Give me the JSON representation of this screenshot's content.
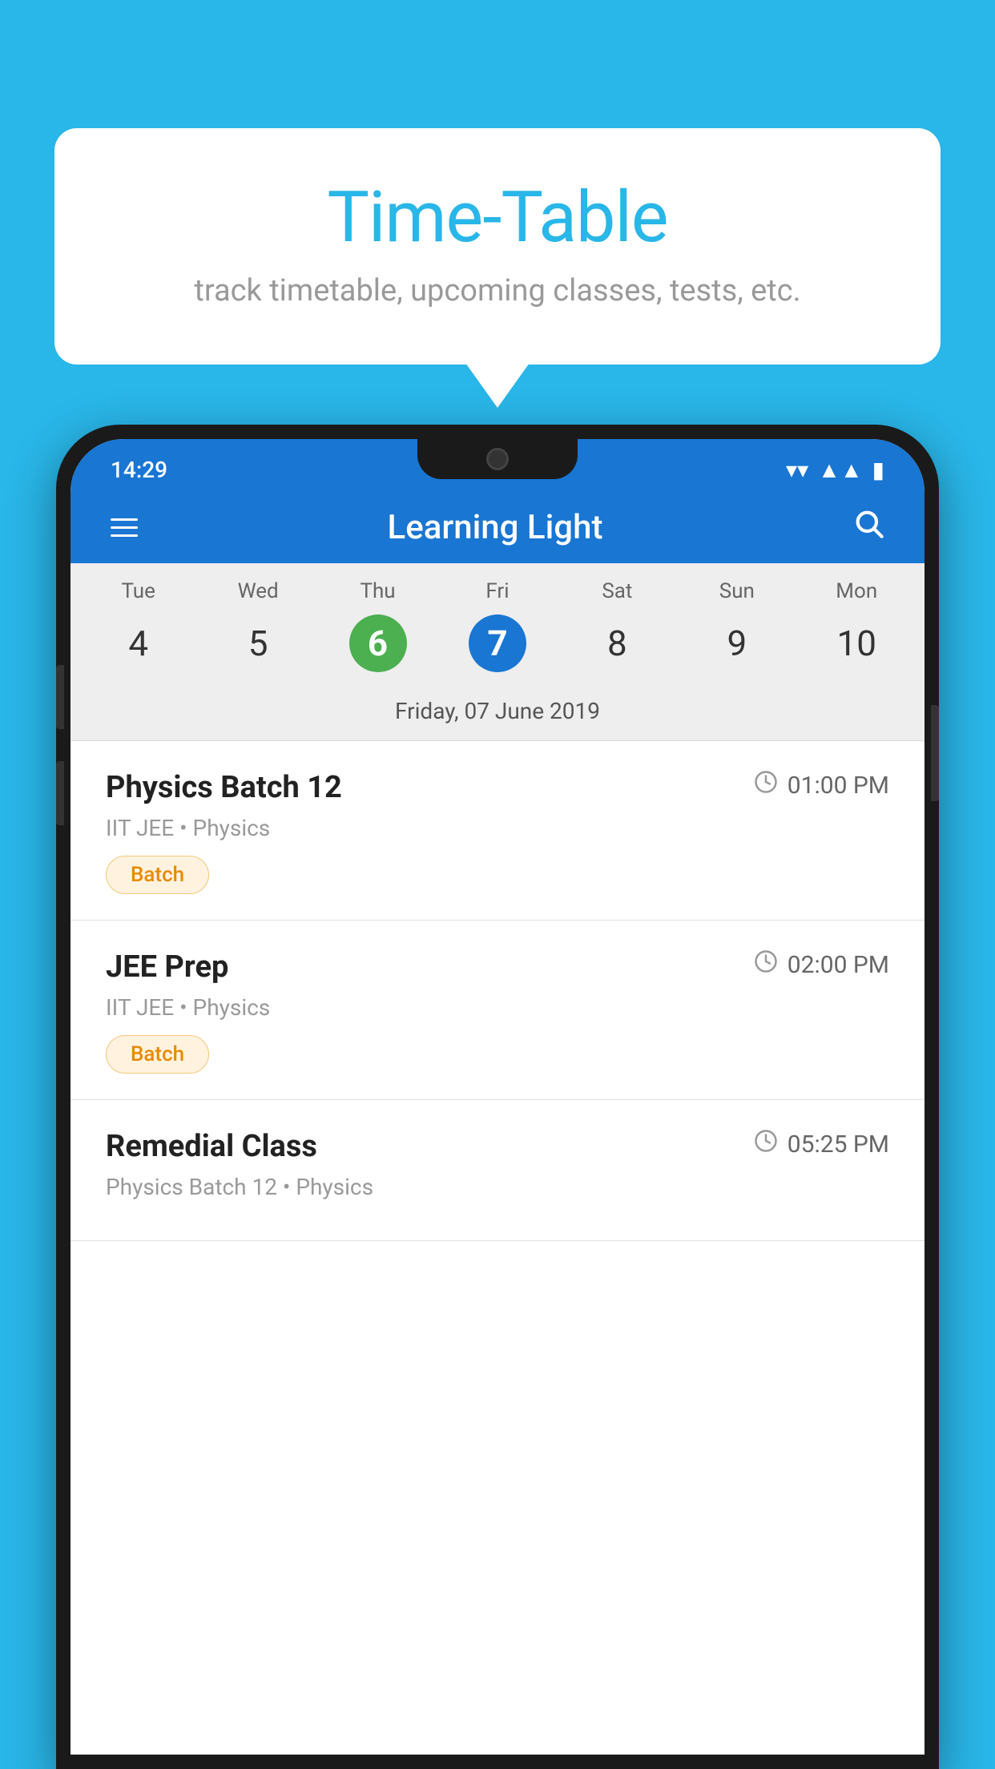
{
  "page": {
    "background_color": "#29b6e8"
  },
  "bubble": {
    "title": "Time-Table",
    "subtitle": "track timetable, upcoming classes, tests, etc."
  },
  "app": {
    "status_time": "14:29",
    "app_name": "Learning Light"
  },
  "calendar": {
    "days": [
      {
        "label": "Tue",
        "number": "4",
        "state": "normal"
      },
      {
        "label": "Wed",
        "number": "5",
        "state": "normal"
      },
      {
        "label": "Thu",
        "number": "6",
        "state": "today"
      },
      {
        "label": "Fri",
        "number": "7",
        "state": "selected"
      },
      {
        "label": "Sat",
        "number": "8",
        "state": "normal"
      },
      {
        "label": "Sun",
        "number": "9",
        "state": "normal"
      },
      {
        "label": "Mon",
        "number": "10",
        "state": "normal"
      }
    ],
    "selected_date": "Friday, 07 June 2019"
  },
  "schedule": [
    {
      "name": "Physics Batch 12",
      "time": "01:00 PM",
      "category": "IIT JEE • Physics",
      "badge": "Batch"
    },
    {
      "name": "JEE Prep",
      "time": "02:00 PM",
      "category": "IIT JEE • Physics",
      "badge": "Batch"
    },
    {
      "name": "Remedial Class",
      "time": "05:25 PM",
      "category": "Physics Batch 12 • Physics",
      "badge": ""
    }
  ],
  "icons": {
    "hamburger": "☰",
    "search": "🔍",
    "clock": "🕐"
  }
}
